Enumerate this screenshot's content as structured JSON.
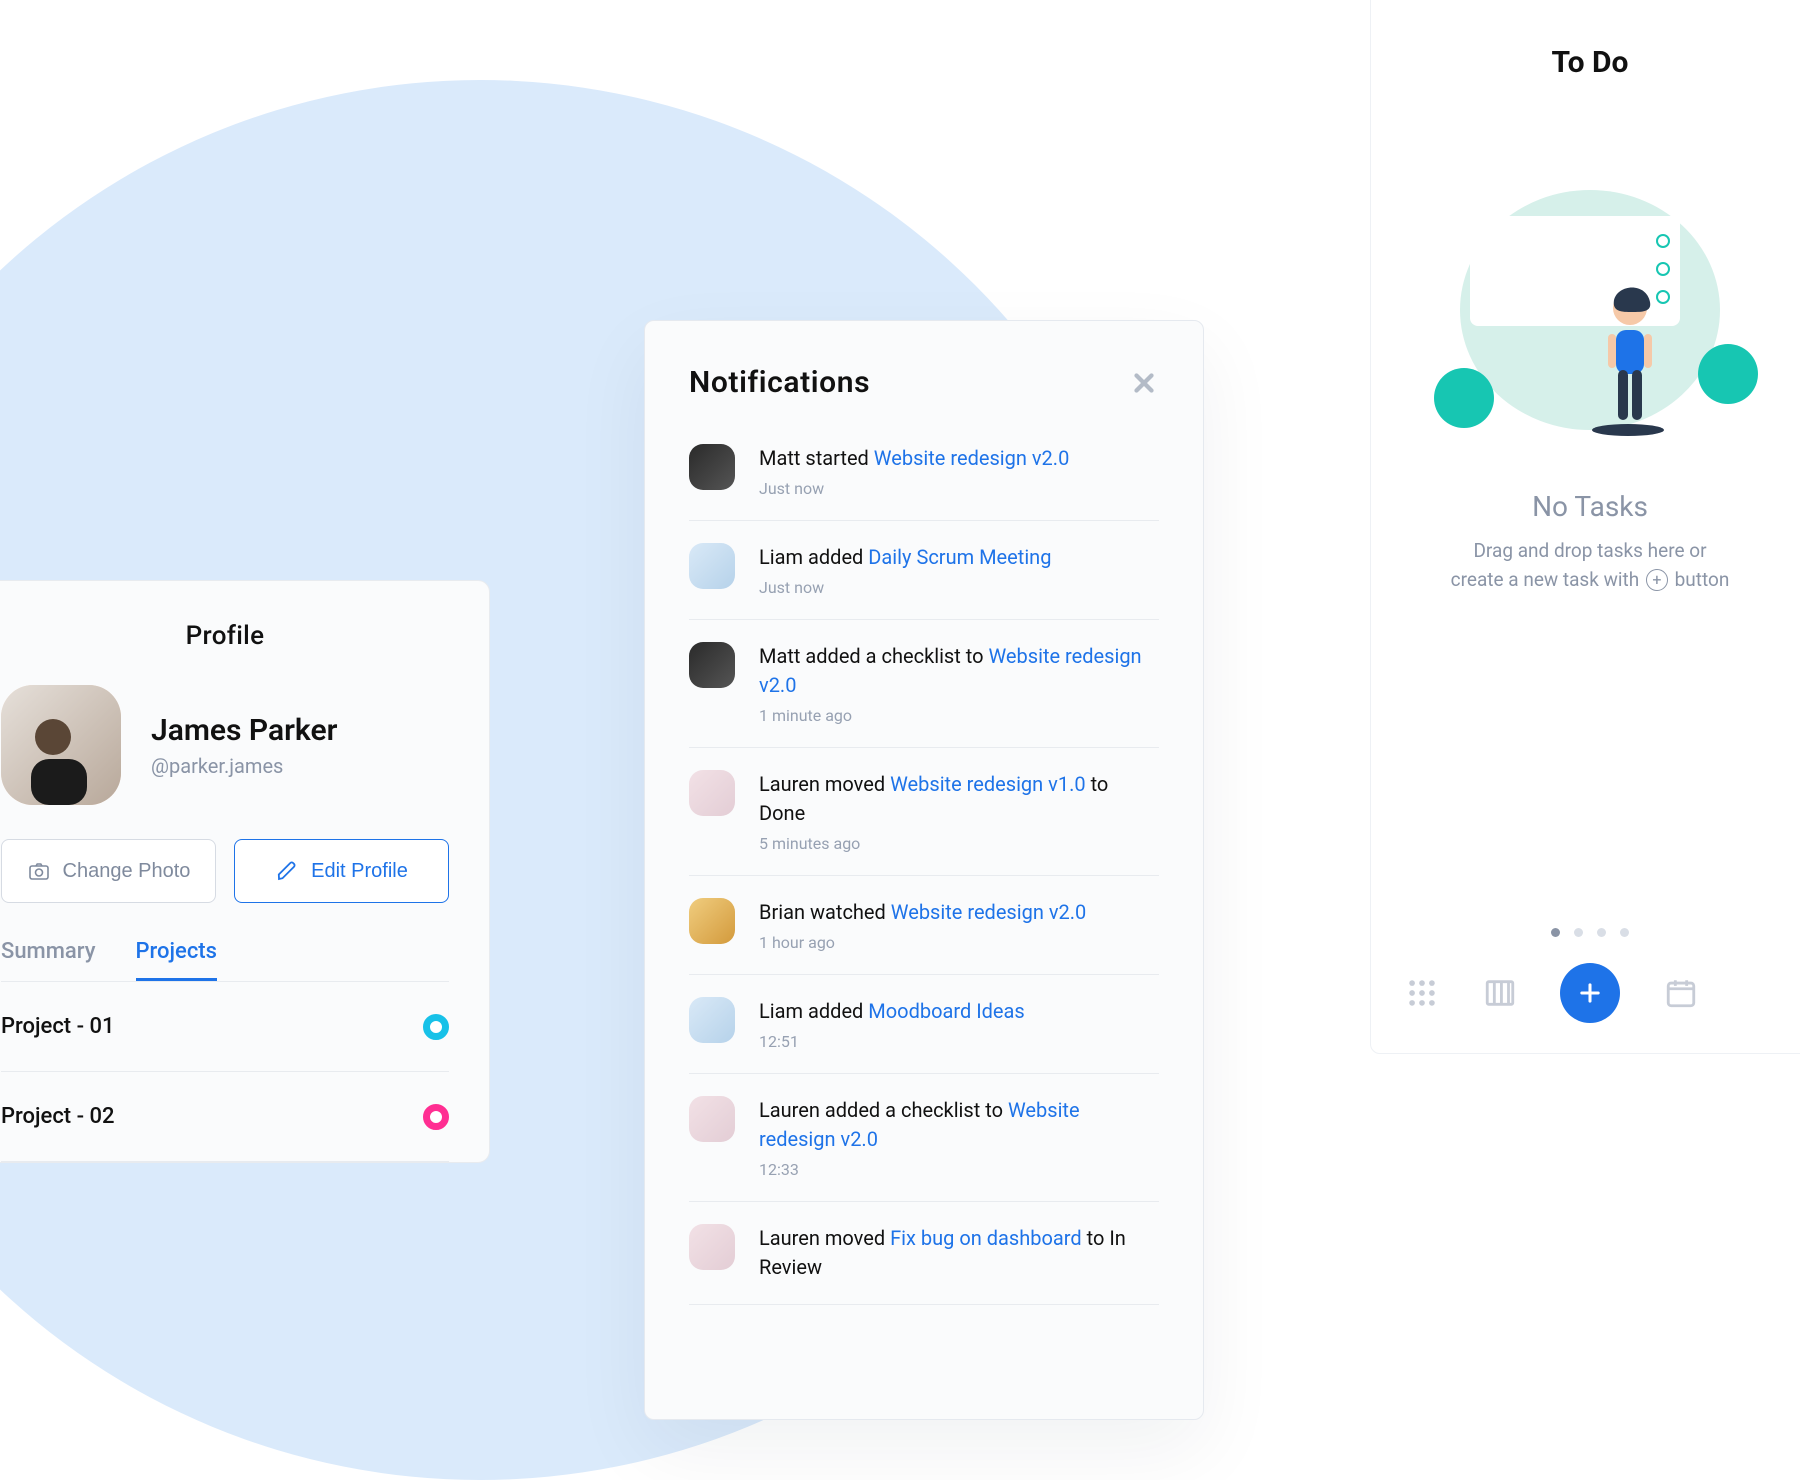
{
  "profile": {
    "title": "Profile",
    "name": "James Parker",
    "handle": "@parker.james",
    "change_photo_label": "Change Photo",
    "edit_profile_label": "Edit Profile",
    "tabs": {
      "summary": "Summary",
      "projects": "Projects"
    },
    "projects": [
      {
        "label": "Project - 01",
        "color": "teal"
      },
      {
        "label": "Project - 02",
        "color": "pink"
      }
    ]
  },
  "notifications": {
    "title": "Notifications",
    "items": [
      {
        "avatar": "a",
        "text_prefix": "Matt started ",
        "link": "Website redesign v2.0",
        "text_suffix": "",
        "time": "Just now"
      },
      {
        "avatar": "b",
        "text_prefix": "Liam added ",
        "link": "Daily Scrum Meeting",
        "text_suffix": "",
        "time": "Just now"
      },
      {
        "avatar": "a",
        "text_prefix": "Matt added a checklist to ",
        "link": "Website redesign v2.0",
        "text_suffix": "",
        "time": "1 minute ago"
      },
      {
        "avatar": "c",
        "text_prefix": "Lauren moved ",
        "link": "Website redesign v1.0",
        "text_suffix": " to Done",
        "time": "5 minutes ago"
      },
      {
        "avatar": "d",
        "text_prefix": "Brian watched ",
        "link": "Website redesign v2.0",
        "text_suffix": "",
        "time": "1 hour ago"
      },
      {
        "avatar": "b",
        "text_prefix": "Liam added ",
        "link": "Moodboard Ideas",
        "text_suffix": "",
        "time": "12:51"
      },
      {
        "avatar": "c",
        "text_prefix": "Lauren added a checklist to ",
        "link": "Website redesign v2.0",
        "text_suffix": "",
        "time": "12:33"
      },
      {
        "avatar": "c",
        "text_prefix": "Lauren moved ",
        "link": "Fix bug on dashboard",
        "text_suffix": " to In Review",
        "time": ""
      }
    ]
  },
  "todo": {
    "title": "To Do",
    "empty_title": "No Tasks",
    "empty_sub_1": "Drag and drop tasks here or",
    "empty_sub_2": "create a new task with",
    "empty_sub_3": "button"
  }
}
